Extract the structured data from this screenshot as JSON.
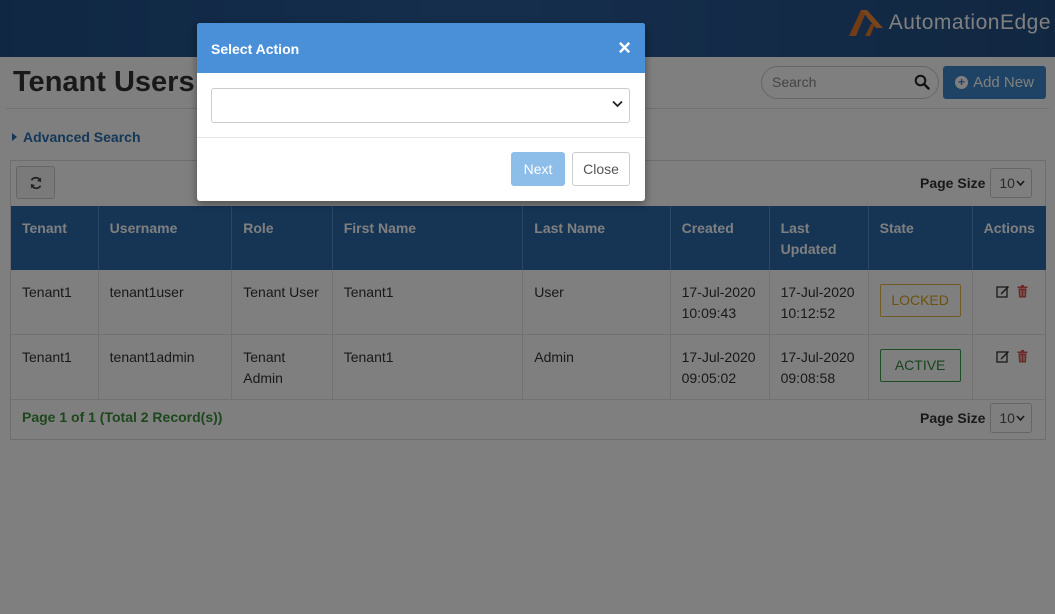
{
  "header": {
    "brand_name": "AutomationEdge",
    "colors": {
      "brand_orange": "#e3772a",
      "header_blue": "#234f83"
    }
  },
  "page": {
    "title": "Tenant Users",
    "search_placeholder": "Search",
    "add_new_label": "Add New",
    "advanced_search_label": "Advanced Search"
  },
  "grid": {
    "page_size_label": "Page Size",
    "page_size_value": "10",
    "columns": [
      "Tenant",
      "Username",
      "Role",
      "First Name",
      "Last Name",
      "Created",
      "Last Updated",
      "State",
      "Actions"
    ],
    "rows": [
      {
        "tenant": "Tenant1",
        "username": "tenant1user",
        "role": "Tenant User",
        "first_name": "Tenant1",
        "last_name": "User",
        "created": "17-Jul-2020 10:09:43",
        "last_updated": "17-Jul-2020 10:12:52",
        "state": "LOCKED"
      },
      {
        "tenant": "Tenant1",
        "username": "tenant1admin",
        "role": "Tenant Admin",
        "first_name": "Tenant1",
        "last_name": "Admin",
        "created": "17-Jul-2020 09:05:02",
        "last_updated": "17-Jul-2020 09:08:58",
        "state": "ACTIVE"
      }
    ],
    "pager_text": "Page 1 of 1 (Total 2 Record(s))",
    "icons": [
      "refresh-icon",
      "edit-icon",
      "delete-icon"
    ]
  },
  "modal": {
    "title": "Select Action",
    "close_symbol": "×",
    "select_value": "",
    "next_label": "Next",
    "close_label": "Close"
  }
}
